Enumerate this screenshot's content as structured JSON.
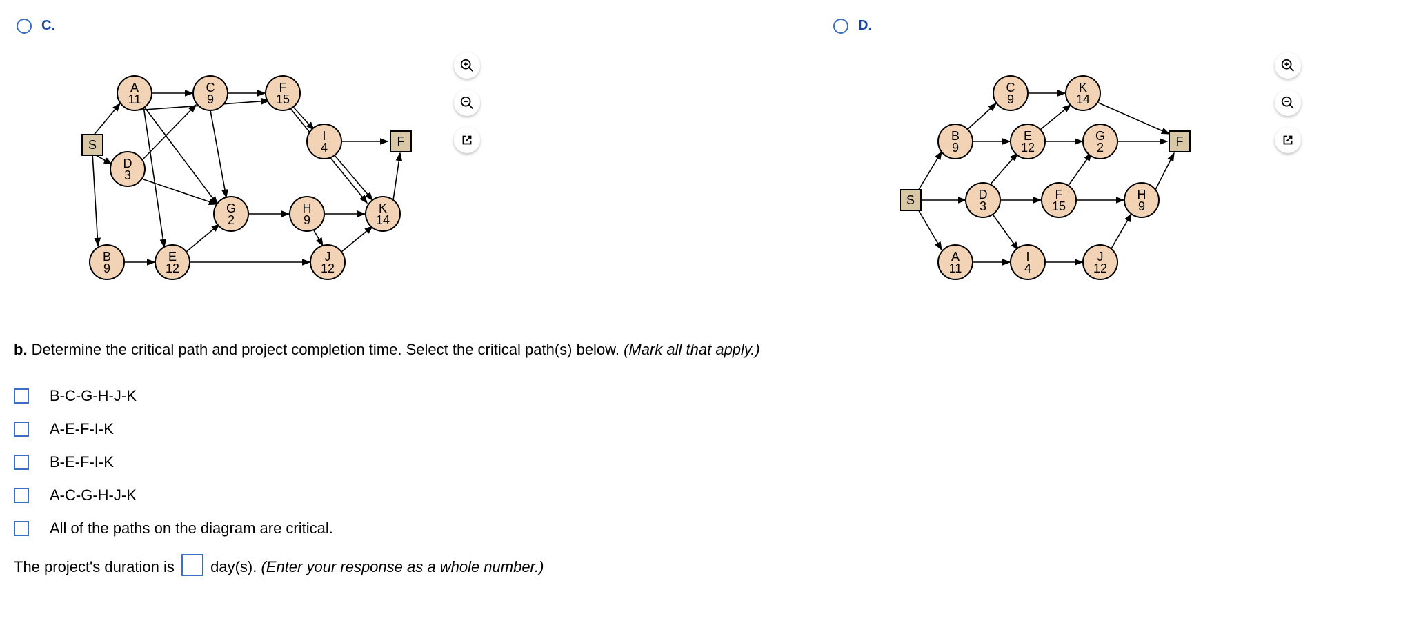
{
  "options": {
    "C": {
      "label": "C."
    },
    "D": {
      "label": "D."
    }
  },
  "terminals": {
    "start": "S",
    "finish": "F"
  },
  "diagramC": {
    "nodes": {
      "A": {
        "label": "A",
        "value": "11"
      },
      "B": {
        "label": "B",
        "value": "9"
      },
      "C": {
        "label": "C",
        "value": "9"
      },
      "D": {
        "label": "D",
        "value": "3"
      },
      "E": {
        "label": "E",
        "value": "12"
      },
      "F": {
        "label": "F",
        "value": "15"
      },
      "G": {
        "label": "G",
        "value": "2"
      },
      "H": {
        "label": "H",
        "value": "9"
      },
      "I": {
        "label": "I",
        "value": "4"
      },
      "J": {
        "label": "J",
        "value": "12"
      },
      "K": {
        "label": "K",
        "value": "14"
      }
    }
  },
  "diagramD": {
    "nodes": {
      "A": {
        "label": "A",
        "value": "11"
      },
      "B": {
        "label": "B",
        "value": "9"
      },
      "C": {
        "label": "C",
        "value": "9"
      },
      "D": {
        "label": "D",
        "value": "3"
      },
      "E": {
        "label": "E",
        "value": "12"
      },
      "F": {
        "label": "F",
        "value": "15"
      },
      "G": {
        "label": "G",
        "value": "2"
      },
      "H": {
        "label": "H",
        "value": "9"
      },
      "I": {
        "label": "I",
        "value": "4"
      },
      "J": {
        "label": "J",
        "value": "12"
      },
      "K": {
        "label": "K",
        "value": "14"
      }
    }
  },
  "part_b": {
    "prefix": "b.",
    "text": " Determine the critical path and project completion time. Select the critical path(s) below. ",
    "hint": "(Mark all that apply.)",
    "choices": [
      "B-C-G-H-J-K",
      "A-E-F-I-K",
      "B-E-F-I-K",
      "A-C-G-H-J-K",
      "All of the paths on the diagram are critical."
    ],
    "duration_pre": "The project's duration is ",
    "duration_post": " day(s). ",
    "duration_hint": "(Enter your response as a whole number.)"
  }
}
